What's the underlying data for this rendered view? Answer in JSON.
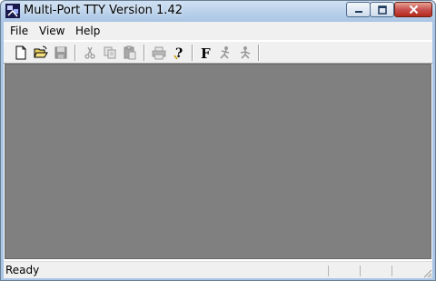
{
  "window": {
    "title": "Multi-Port TTY Version 1.42"
  },
  "menubar": {
    "items": [
      "File",
      "View",
      "Help"
    ]
  },
  "toolbar": {
    "buttons": [
      {
        "icon": "new-document-icon",
        "enabled": true
      },
      {
        "icon": "open-folder-icon",
        "enabled": true
      },
      {
        "icon": "save-disk-icon",
        "enabled": false
      },
      {
        "icon": "cut-scissors-icon",
        "enabled": false
      },
      {
        "icon": "copy-icon",
        "enabled": false
      },
      {
        "icon": "paste-clipboard-icon",
        "enabled": false
      },
      {
        "icon": "print-icon",
        "enabled": false
      },
      {
        "icon": "help-question-icon",
        "enabled": true
      },
      {
        "icon": "font-f-icon",
        "enabled": true
      },
      {
        "icon": "connect-icon",
        "enabled": false
      },
      {
        "icon": "disconnect-icon",
        "enabled": false
      }
    ]
  },
  "statusbar": {
    "text": "Ready"
  },
  "colors": {
    "workspace": "#808080",
    "chrome": "#f0f0f0",
    "close_button": "#c75050"
  }
}
